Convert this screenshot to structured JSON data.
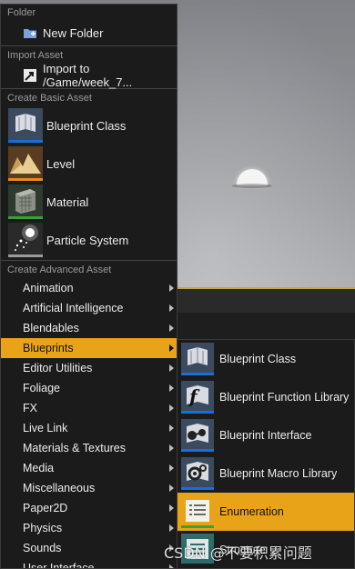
{
  "colors": {
    "highlight": "#e8a318",
    "menu_bg": "#1b1b1b",
    "blueprint_bar": "#1a6fd6",
    "level_bar": "#e88a18",
    "material_bar": "#3aa13a",
    "particle_bar": "#9a9a9a"
  },
  "menu": {
    "folder_header": "Folder",
    "new_folder": {
      "label": "New Folder",
      "icon": "new-folder-icon"
    },
    "import_header": "Import Asset",
    "import_item": {
      "label": "Import to /Game/week_7...",
      "icon": "import-icon"
    },
    "basic_header": "Create Basic Asset",
    "basic_items": [
      {
        "label": "Blueprint Class",
        "icon": "blueprint-class-icon"
      },
      {
        "label": "Level",
        "icon": "level-icon"
      },
      {
        "label": "Material",
        "icon": "material-icon"
      },
      {
        "label": "Particle System",
        "icon": "particle-system-icon"
      }
    ],
    "advanced_header": "Create Advanced Asset",
    "categories": [
      {
        "label": "Animation"
      },
      {
        "label": "Artificial Intelligence"
      },
      {
        "label": "Blendables"
      },
      {
        "label": "Blueprints"
      },
      {
        "label": "Editor Utilities"
      },
      {
        "label": "Foliage"
      },
      {
        "label": "FX"
      },
      {
        "label": "Live Link"
      },
      {
        "label": "Materials & Textures"
      },
      {
        "label": "Media"
      },
      {
        "label": "Miscellaneous"
      },
      {
        "label": "Paper2D"
      },
      {
        "label": "Physics"
      },
      {
        "label": "Sounds"
      },
      {
        "label": "User Interface"
      }
    ],
    "active_category": "Blueprints"
  },
  "submenu": {
    "items": [
      {
        "label": "Blueprint Class",
        "icon": "blueprint-class-icon"
      },
      {
        "label": "Blueprint Function Library",
        "icon": "function-library-icon"
      },
      {
        "label": "Blueprint Interface",
        "icon": "blueprint-interface-icon"
      },
      {
        "label": "Blueprint Macro Library",
        "icon": "macro-library-icon"
      },
      {
        "label": "Enumeration",
        "icon": "enumeration-icon"
      },
      {
        "label": "Structure",
        "icon": "structure-icon"
      }
    ],
    "highlighted": "Enumeration"
  },
  "watermark": "CSDN @不要积累问题"
}
